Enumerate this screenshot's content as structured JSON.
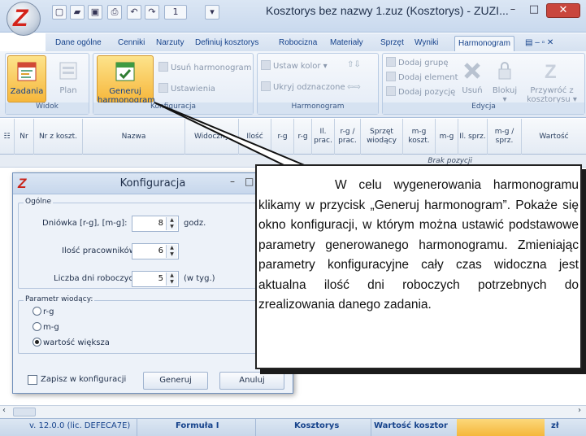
{
  "window": {
    "title": "Kosztorys bez nazwy 1.zuz (Kosztorys) - ZUZI...",
    "logo_letter": "Z",
    "quick_access_number": "1"
  },
  "tabs": [
    "Dane ogólne",
    "Cenniki",
    "Narzuty",
    "Definiuj kosztorys",
    "Robocizna",
    "Materiały",
    "Sprzęt",
    "Wyniki",
    "Harmonogram"
  ],
  "active_tab": "Harmonogram",
  "ribbon": {
    "widok": {
      "label": "Widok",
      "zadania": "Zadania",
      "plan": "Plan"
    },
    "konfiguracja": {
      "label": "Konfiguracja",
      "generuj_line1": "Generuj",
      "generuj_line2": "harmonogram",
      "usun": "Usuń harmonogram",
      "ustawienia": "Ustawienia"
    },
    "harmonogram": {
      "label": "Harmonogram",
      "ustaw_kolor": "Ustaw kolor",
      "ukryj": "Ukryj odznaczone"
    },
    "dodaj": {
      "grupe": "Dodaj grupę",
      "element": "Dodaj element",
      "pozycje": "Dodaj pozycję"
    },
    "edycja": {
      "label": "Edycja",
      "usun": "Usuń",
      "blokuj": "Blokuj",
      "przywroc_line1": "Przywróć z",
      "przywroc_line2": "kosztorysu"
    }
  },
  "grid": {
    "columns": [
      "Nr",
      "Nr z koszt.",
      "Nazwa",
      "Widoczny",
      "Ilość",
      "r-g",
      "r-g",
      "Il. prac.",
      "r-g / prac.",
      "Sprzęt wiodący",
      "m-g koszt.",
      "m-g",
      "Il. sprz.",
      "m-g / sprz.",
      "Wartość"
    ],
    "empty_text": "Brak pozycji"
  },
  "dialog": {
    "title": "Konfiguracja",
    "section_general": "Ogólne",
    "dniowka_label": "Dniówka [r-g], [m-g]:",
    "dniowka_value": "8",
    "dniowka_unit": "godz.",
    "pracownicy_label": "Ilość pracowników:",
    "pracownicy_value": "6",
    "dni_label": "Liczba dni roboczych:",
    "dni_value": "5",
    "dni_unit": "(w tyg.)",
    "section_param": "Parametr wiodący:",
    "options": [
      "r-g",
      "m-g",
      "wartość większa"
    ],
    "selected_option": "wartość większa",
    "save_checkbox": "Zapisz w konfiguracji",
    "generuj_button": "Generuj",
    "anuluj_button": "Anuluj"
  },
  "callout": {
    "text": "W celu wygenerowania harmonogramu klikamy w przycisk „Generuj harmonogram”. Pokaże się okno konfiguracji, w którym można ustawić podstawowe parametry generowanego harmonogramu. Zmieniając parametry konfiguracyjne cały czas widoczna jest aktualna ilość dni roboczych potrzebnych do zrealizowania danego zadania."
  },
  "statusbar": {
    "version": "v. 12.0.0 (lic. DEFECA7E)",
    "formula": "Formuła I",
    "mode": "Kosztorys",
    "value_label": "Wartość kosztor",
    "currency": "zł"
  },
  "colors": {
    "accent": "#15428b",
    "highlight": "#f6b73c",
    "brand_red": "#d4231a"
  }
}
